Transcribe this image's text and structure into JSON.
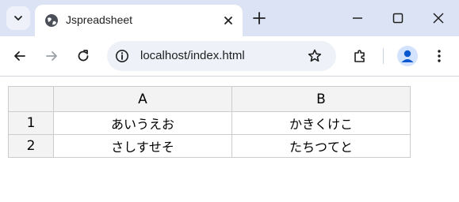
{
  "browser": {
    "tab_title": "Jspreadsheet",
    "url": "localhost/index.html"
  },
  "sheet": {
    "columns": [
      "A",
      "B"
    ],
    "rows": [
      {
        "index": "1",
        "cells": [
          "あいうえお",
          "かきくけこ"
        ]
      },
      {
        "index": "2",
        "cells": [
          "さしすせそ",
          "たちつてと"
        ]
      }
    ]
  },
  "colors": {
    "tabbar_bg": "#dce3f4",
    "header_bg": "#f3f3f3",
    "grid_border": "#cccccc",
    "accent": "#0b57d0"
  }
}
